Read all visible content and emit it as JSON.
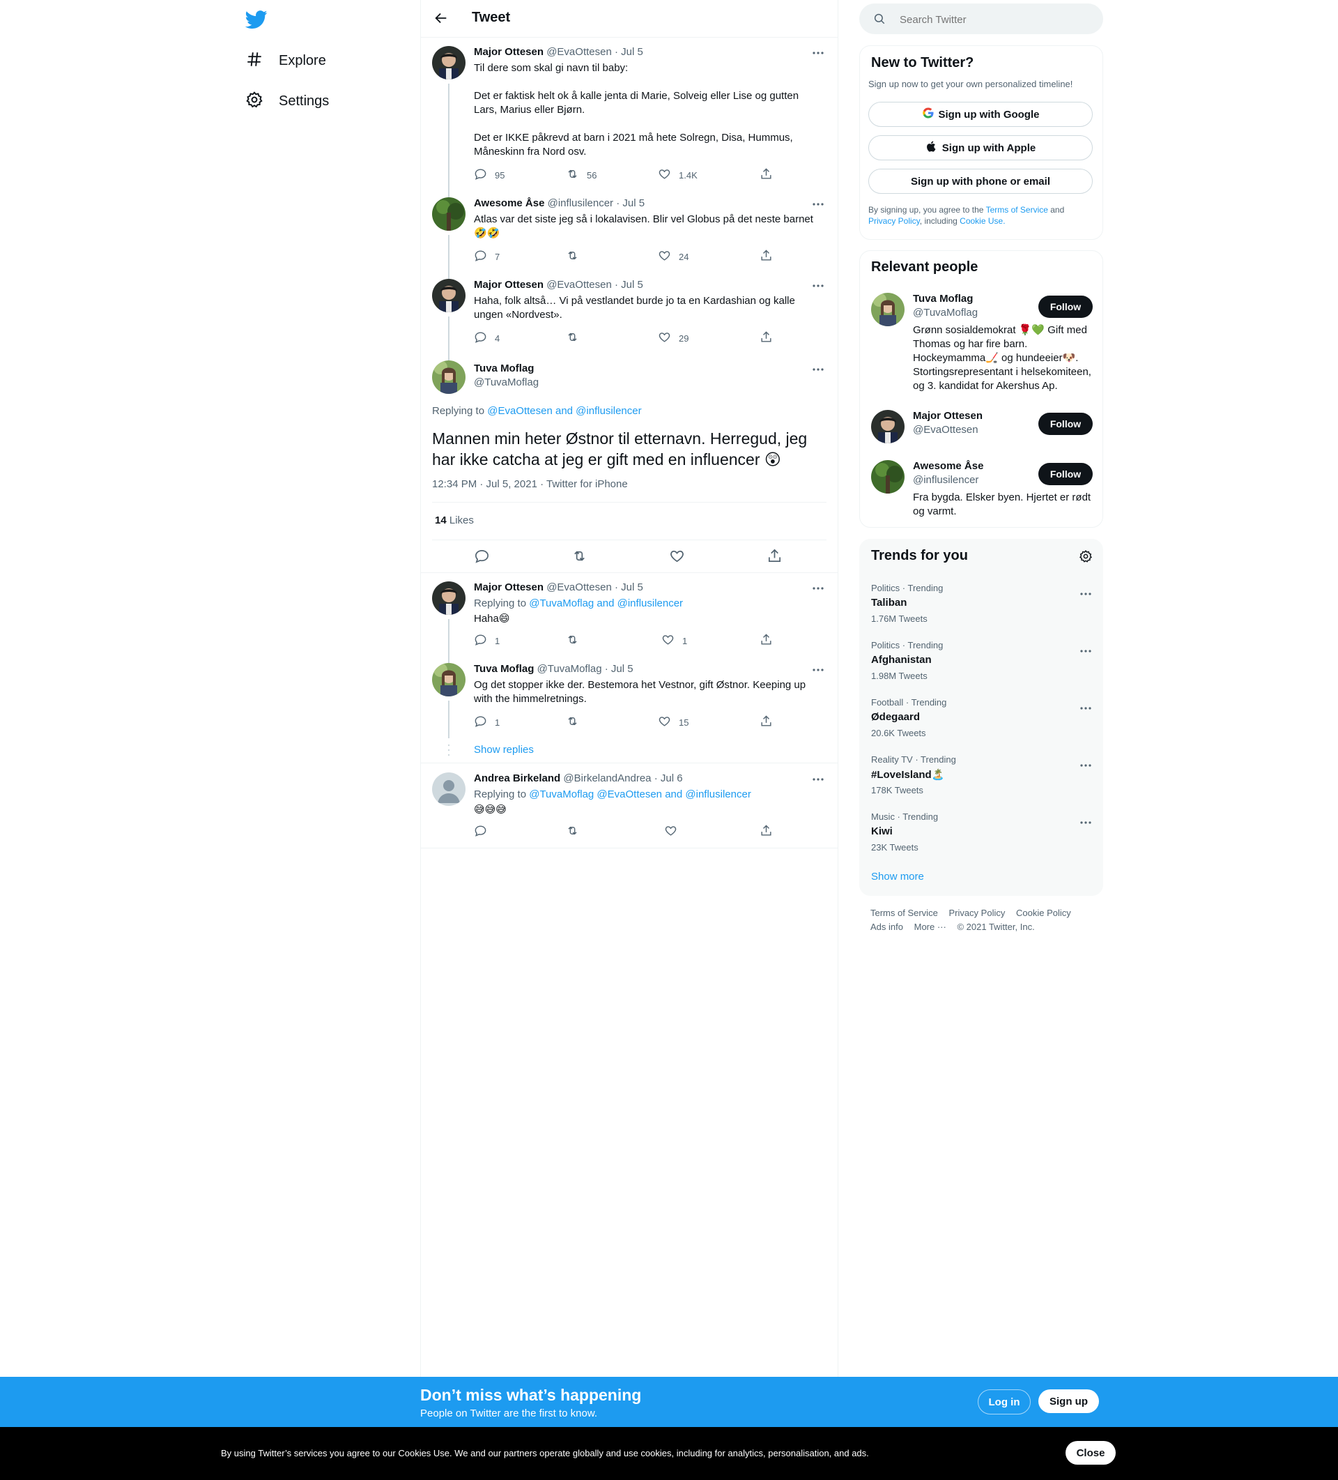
{
  "nav": {
    "explore": "Explore",
    "settings": "Settings"
  },
  "header": {
    "title": "Tweet"
  },
  "thread": [
    {
      "name": "Major Ottesen",
      "meta": "@EvaOttesen · Jul 5",
      "text": "Til dere som skal gi navn til baby:\n\nDet er faktisk helt ok å kalle jenta di Marie, Solveig eller Lise og gutten Lars, Marius eller Bjørn.\n\nDet er IKKE påkrevd at barn i 2021 må hete Solregn, Disa, Hummus, Måneskinn fra Nord osv.",
      "replies": "95",
      "retweets": "56",
      "likes": "1.4K"
    },
    {
      "name": "Awesome Åse",
      "meta": "@influsilencer · Jul 5",
      "text": "Atlas var det siste jeg så i lokalavisen.  Blir vel Globus på det neste barnet 🤣🤣",
      "replies": "7",
      "retweets": "",
      "likes": "24"
    },
    {
      "name": "Major Ottesen",
      "meta": "@EvaOttesen · Jul 5",
      "text": "Haha, folk altså… Vi på vestlandet burde jo ta en Kardashian og kalle ungen «Nordvest».",
      "replies": "4",
      "retweets": "",
      "likes": "29"
    }
  ],
  "focal": {
    "name": "Tuva Moflag",
    "handle": "@TuvaMoflag",
    "replying_prefix": "Replying to ",
    "replying_to": "@EvaOttesen and @influsilencer",
    "text": "Mannen min heter Østnor til etternavn. Herregud, jeg har ikke catcha at jeg er gift med en influencer 😲",
    "timestamp": "12:34 PM · Jul 5, 2021 · Twitter for iPhone",
    "likes_count": "14",
    "likes_label": "Likes"
  },
  "replies": [
    {
      "name": "Major Ottesen",
      "meta": "@EvaOttesen · Jul 5",
      "replying_prefix": "Replying to ",
      "replying_to": "@TuvaMoflag and @influsilencer",
      "text": "Haha😄",
      "replies": "1",
      "retweets": "",
      "likes": "1"
    },
    {
      "name": "Tuva Moflag",
      "meta": "@TuvaMoflag · Jul 5",
      "text": "Og det stopper ikke der. Bestemora het Vestnor, gift Østnor. Keeping up with the himmelretnings.",
      "replies": "1",
      "retweets": "",
      "likes": "15"
    },
    {
      "name": "Andrea Birkeland",
      "meta": "@BirkelandAndrea · Jul 6",
      "replying_prefix": "Replying to ",
      "replying_to": "@TuvaMoflag @EvaOttesen and @influsilencer",
      "text": "😅😅😅",
      "replies": "",
      "retweets": "",
      "likes": ""
    }
  ],
  "show_replies": "Show replies",
  "search": {
    "placeholder": "Search Twitter"
  },
  "new_to_twitter": {
    "title": "New to Twitter?",
    "subtitle": "Sign up now to get your own personalized timeline!",
    "google": "Sign up with Google",
    "apple": "Sign up with Apple",
    "phone": "Sign up with phone or email",
    "legal_1": "By signing up, you agree to the ",
    "terms": "Terms of Service",
    "legal_2": " and ",
    "privacy": "Privacy Policy",
    "legal_3": ", including ",
    "cookie": "Cookie Use."
  },
  "relevant_people": {
    "title": "Relevant people",
    "follow": "Follow",
    "people": [
      {
        "name": "Tuva Moflag",
        "handle": "@TuvaMoflag",
        "bio": "Grønn sosialdemokrat 🌹💚 Gift med Thomas og har fire barn. Hockeymamma🏒 og hundeeier🐶. Stortingsrepresentant i helsekomiteen, og 3. kandidat for Akershus Ap."
      },
      {
        "name": "Major Ottesen",
        "handle": "@EvaOttesen",
        "bio": ""
      },
      {
        "name": "Awesome Åse",
        "handle": "@influsilencer",
        "bio": "Fra bygda. Elsker byen. Hjertet er rødt og varmt."
      }
    ]
  },
  "trends": {
    "title": "Trends for you",
    "items": [
      {
        "category": "Politics · Trending",
        "name": "Taliban",
        "count": "1.76M Tweets"
      },
      {
        "category": "Politics · Trending",
        "name": "Afghanistan",
        "count": "1.98M Tweets"
      },
      {
        "category": "Football · Trending",
        "name": "Ødegaard",
        "count": "20.6K Tweets"
      },
      {
        "category": "Reality TV · Trending",
        "name": "#LoveIsland🏝️",
        "count": "178K Tweets"
      },
      {
        "category": "Music · Trending",
        "name": "Kiwi",
        "count": "23K Tweets"
      }
    ],
    "show_more": "Show more"
  },
  "footer": {
    "terms": "Terms of Service",
    "privacy": "Privacy Policy",
    "cookie": "Cookie Policy",
    "ads": "Ads info",
    "more": "More ···",
    "copyright": "© 2021 Twitter, Inc."
  },
  "signup_bar": {
    "heading": "Don’t miss what’s happening",
    "sub": "People on Twitter are the first to know.",
    "login": "Log in",
    "signup": "Sign up"
  },
  "cookie_bar": {
    "text": "By using Twitter’s services you agree to our Cookies Use. We and our partners operate globally and use cookies, including for analytics, personalisation, and ads.",
    "close": "Close"
  },
  "colors": {
    "accent": "#1d9bf0",
    "text": "#0f1419",
    "secondary": "#536471",
    "border": "#eff3f4"
  }
}
